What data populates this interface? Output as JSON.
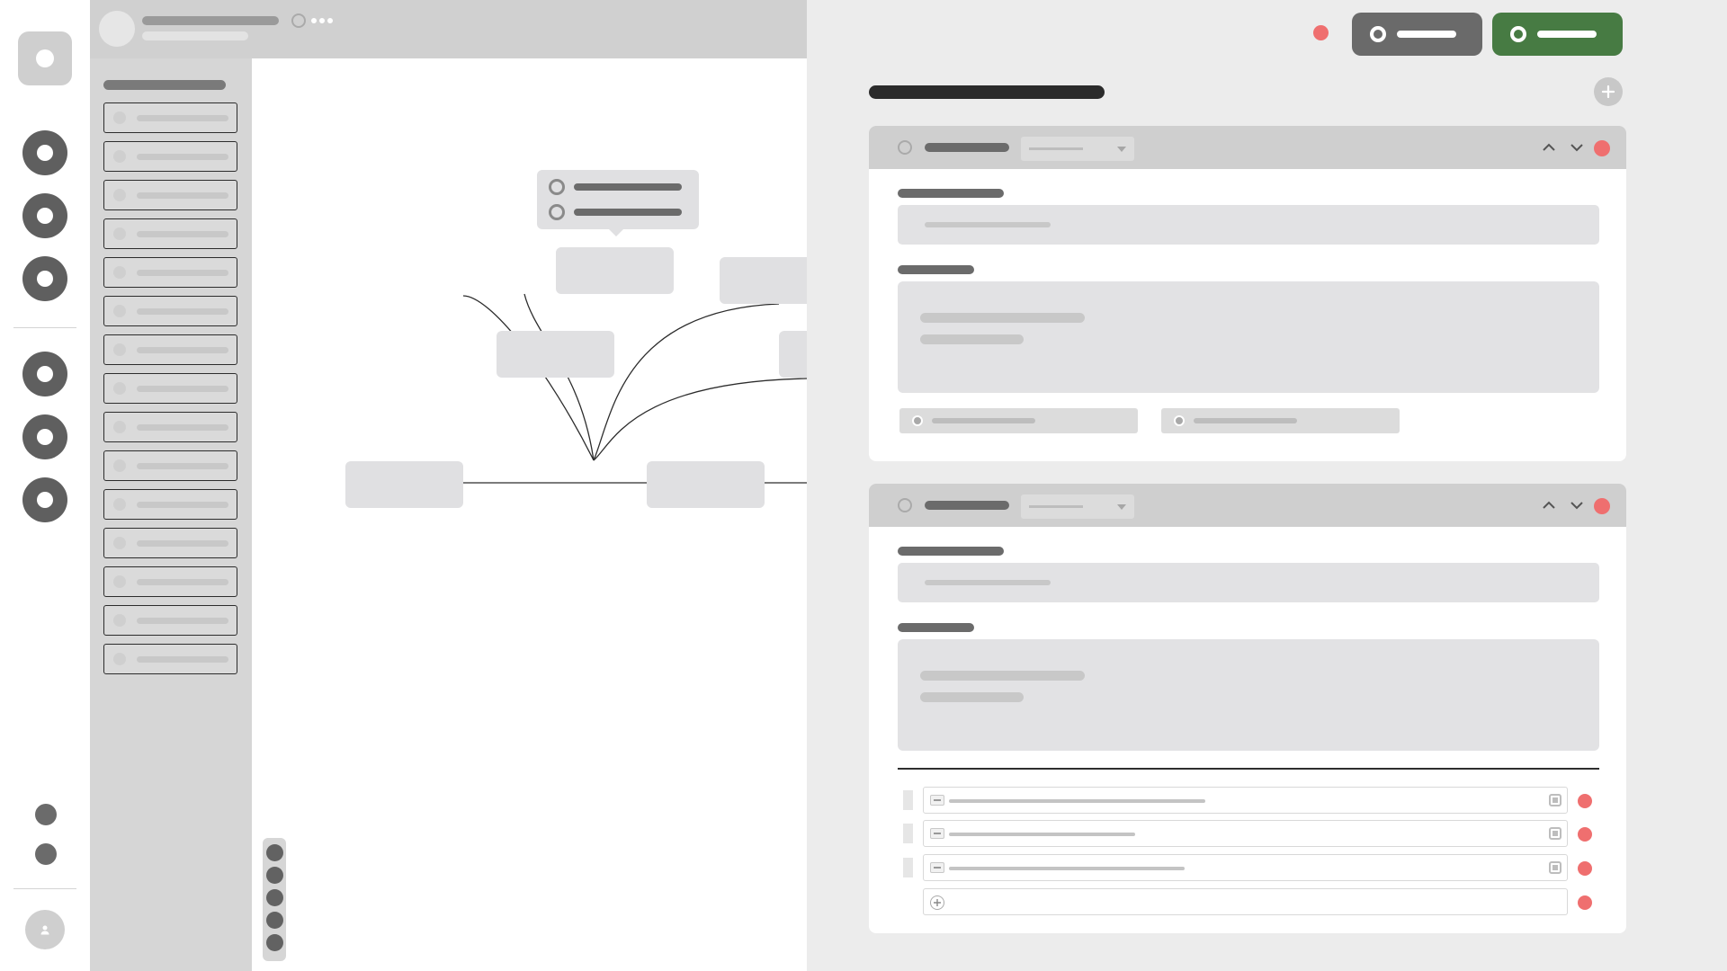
{
  "colors": {
    "accent_green": "#477b43",
    "secondary_button": "#6a6a6a",
    "danger": "#ef6f6f",
    "connector": "#2c2c2c"
  },
  "icons": {
    "rail_logo": "logo-icon",
    "rail_nav": [
      "nav-icon",
      "nav-icon",
      "nav-icon",
      "nav-icon",
      "nav-icon",
      "nav-icon"
    ],
    "rail_bottom": [
      "settings-icon",
      "help-icon"
    ],
    "user": "user-icon",
    "header_more": "more-dots-icon",
    "add": "plus-circle-icon",
    "move_up": "chevron-up-icon",
    "move_down": "chevron-down-icon",
    "delete": "delete-dot-icon"
  },
  "node_list": {
    "item_count": 15
  },
  "canvas": {
    "nodes": [
      "node",
      "node",
      "node",
      "node",
      "node",
      "node"
    ],
    "zoom_controls": 5
  },
  "cards": [
    {
      "field_count": 2,
      "chip_count": 2
    },
    {
      "field_count": 2,
      "row_count": 3
    }
  ]
}
